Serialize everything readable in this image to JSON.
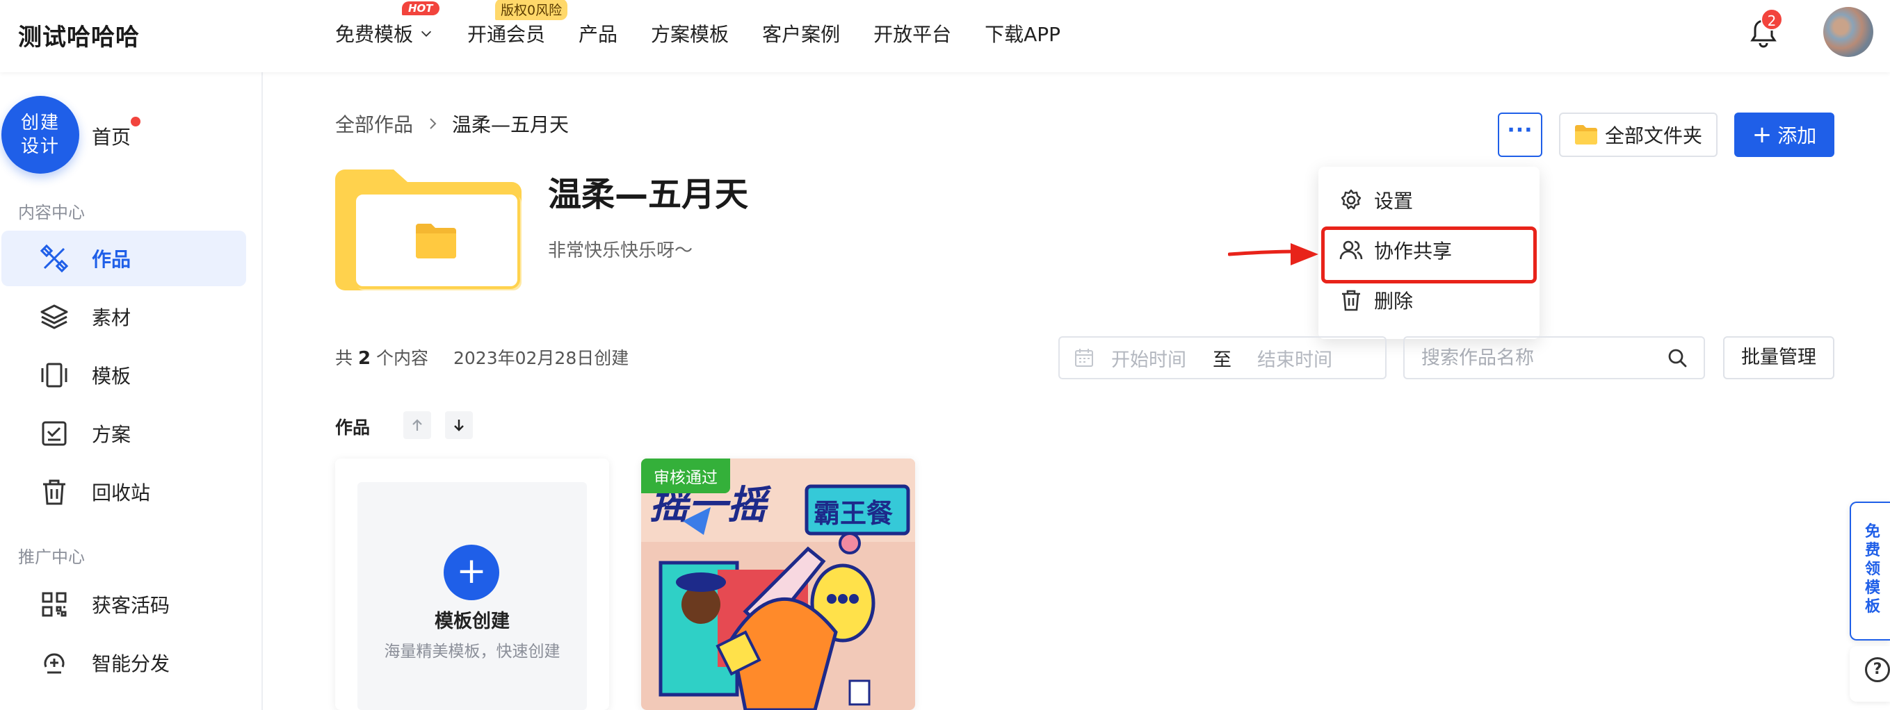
{
  "app": {
    "title": "测试哈哈哈"
  },
  "nav": {
    "items": [
      {
        "label": "免费模板",
        "badge": "HOT",
        "has_dropdown": true
      },
      {
        "label": "开通会员",
        "badge": "版权0风险"
      },
      {
        "label": "产品"
      },
      {
        "label": "方案模板"
      },
      {
        "label": "客户案例"
      },
      {
        "label": "开放平台"
      },
      {
        "label": "下载APP"
      }
    ],
    "notification_count": "2"
  },
  "sidebar": {
    "create_button": "创建\n设计",
    "home_label": "首页",
    "section_content": "内容中心",
    "section_promo": "推广中心",
    "items": [
      {
        "label": "作品",
        "icon": "works-icon",
        "active": true
      },
      {
        "label": "素材",
        "icon": "layers-icon"
      },
      {
        "label": "模板",
        "icon": "template-icon"
      },
      {
        "label": "方案",
        "icon": "checklist-icon"
      },
      {
        "label": "回收站",
        "icon": "trash-icon"
      },
      {
        "label": "获客活码",
        "icon": "qrcode-icon"
      },
      {
        "label": "智能分发",
        "icon": "distribute-icon"
      }
    ]
  },
  "breadcrumb": {
    "root": "全部作品",
    "current": "温柔—五月天"
  },
  "folder": {
    "title": "温柔—五月天",
    "description": "非常快乐快乐呀～"
  },
  "toolbar": {
    "more_label": "···",
    "all_folders_label": "全部文件夹",
    "add_label": "添加"
  },
  "dropdown": {
    "items": [
      {
        "label": "设置",
        "icon": "gear-icon"
      },
      {
        "label": "协作共享",
        "icon": "users-icon",
        "highlighted": true
      },
      {
        "label": "删除",
        "icon": "trash-icon"
      }
    ]
  },
  "stats": {
    "prefix": "共",
    "count": "2",
    "suffix": "个内容",
    "created": "2023年02月28日创建"
  },
  "filters": {
    "start_placeholder": "开始时间",
    "to_label": "至",
    "end_placeholder": "结束时间",
    "search_placeholder": "搜索作品名称",
    "batch_label": "批量管理"
  },
  "works": {
    "label": "作品",
    "create_card": {
      "title": "模板创建",
      "subtitle": "海量精美模板，快速创建"
    },
    "work_card": {
      "status": "审核通过",
      "poster_left": "摇一摇",
      "poster_right": "霸王餐"
    }
  },
  "floating": {
    "side_tab": "免费领模板",
    "help": "?"
  },
  "colors": {
    "primary": "#1f5fe8",
    "danger": "#e8231a",
    "success": "#34b03a",
    "folder": "#ffd24d"
  }
}
